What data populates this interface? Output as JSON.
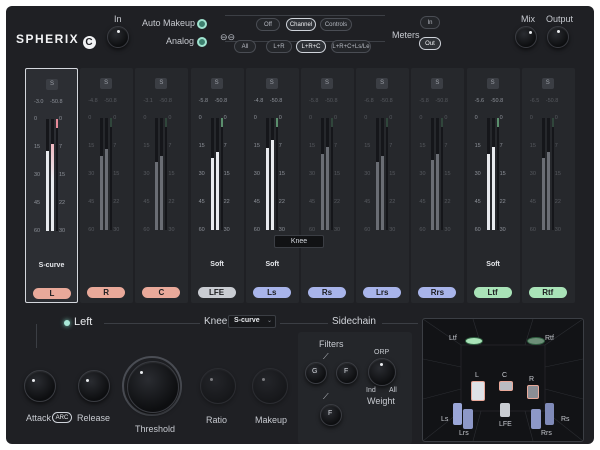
{
  "header": {
    "brand": "SPHERIX",
    "brand_mark": "C",
    "in_label": "In",
    "auto_makeup": "Auto Makeup",
    "analog": "Analog",
    "link_icon": "link-icon",
    "view_buttons": [
      "Off",
      "Channel",
      "Controls"
    ],
    "view_selected": "Channel",
    "channel_buttons": [
      "All",
      "L+R",
      "L+R+C",
      "L+R+C+Ls/Le"
    ],
    "channel_selected": "L+R+C",
    "meters_label": "Meters",
    "meters_in": "In",
    "meters_out": "Out",
    "mix_label": "Mix",
    "output_label": "Output"
  },
  "channels": [
    {
      "name": "L",
      "peak_a": "-3.0",
      "peak_b": "-50.8",
      "mode": "S-curve",
      "color": "#e9a99a",
      "level": 0.78,
      "selected": true,
      "dim": false
    },
    {
      "name": "R",
      "peak_a": "-4.8",
      "peak_b": "-50.8",
      "mode": "",
      "color": "#e9a99a",
      "level": 0.72,
      "selected": false,
      "dim": true
    },
    {
      "name": "C",
      "peak_a": "-3.1",
      "peak_b": "-50.8",
      "mode": "",
      "color": "#e9a99a",
      "level": 0.66,
      "selected": false,
      "dim": true
    },
    {
      "name": "LFE",
      "peak_a": "-5.8",
      "peak_b": "-50.8",
      "mode": "Soft",
      "color": "#c9ccd2",
      "level": 0.7,
      "selected": false,
      "dim": false
    },
    {
      "name": "Ls",
      "peak_a": "-4.8",
      "peak_b": "-50.8",
      "mode": "Soft",
      "color": "#a8b4ea",
      "level": 0.8,
      "selected": false,
      "dim": false
    },
    {
      "name": "Rs",
      "peak_a": "-5.8",
      "peak_b": "-50.8",
      "mode": "",
      "color": "#a8b4ea",
      "level": 0.74,
      "selected": false,
      "dim": true
    },
    {
      "name": "Lrs",
      "peak_a": "-6.8",
      "peak_b": "-50.8",
      "mode": "",
      "color": "#a8b4ea",
      "level": 0.66,
      "selected": false,
      "dim": true
    },
    {
      "name": "Rrs",
      "peak_a": "-5.8",
      "peak_b": "-50.8",
      "mode": "",
      "color": "#a8b4ea",
      "level": 0.68,
      "selected": false,
      "dim": true
    },
    {
      "name": "Ltf",
      "peak_a": "-5.6",
      "peak_b": "-50.8",
      "mode": "Soft",
      "color": "#a9e3b8",
      "level": 0.74,
      "selected": false,
      "dim": false
    },
    {
      "name": "Rtf",
      "peak_a": "-6.5",
      "peak_b": "-50.8",
      "mode": "",
      "color": "#a9e3b8",
      "level": 0.7,
      "selected": false,
      "dim": true
    }
  ],
  "meter_scale": [
    "0",
    "15",
    "30",
    "45",
    "60"
  ],
  "meter_scale_right": [
    "0",
    "7",
    "15",
    "22",
    "30"
  ],
  "knee_tooltip": "Knee",
  "controls": {
    "channel_label": "Left",
    "knee_label": "Knee",
    "knee_value": "S-curve",
    "sidechain_label": "Sidechain",
    "attack_label": "Attack",
    "arc_label": "ARC",
    "release_label": "Release",
    "threshold_label": "Threshold",
    "ratio_label": "Ratio",
    "makeup_label": "Makeup",
    "filters_label": "Filters",
    "filter_g": "G",
    "filter_f1": "F",
    "filter_f2": "F",
    "weight_label": "Weight",
    "weight_orp": "ORP",
    "weight_ind": "Ind",
    "weight_all": "All"
  },
  "speakers": {
    "ltf": "Ltf",
    "rtf": "Rtf",
    "l": "L",
    "c": "C",
    "r": "R",
    "ls": "Ls",
    "rs": "Rs",
    "lrs": "Lrs",
    "rrs": "Rrs",
    "lfe": "LFE"
  },
  "colors": {
    "accent_green": "#9fe3cf",
    "front": "#e9a99a",
    "surround": "#a8b4ea",
    "top": "#a9e3b8"
  }
}
